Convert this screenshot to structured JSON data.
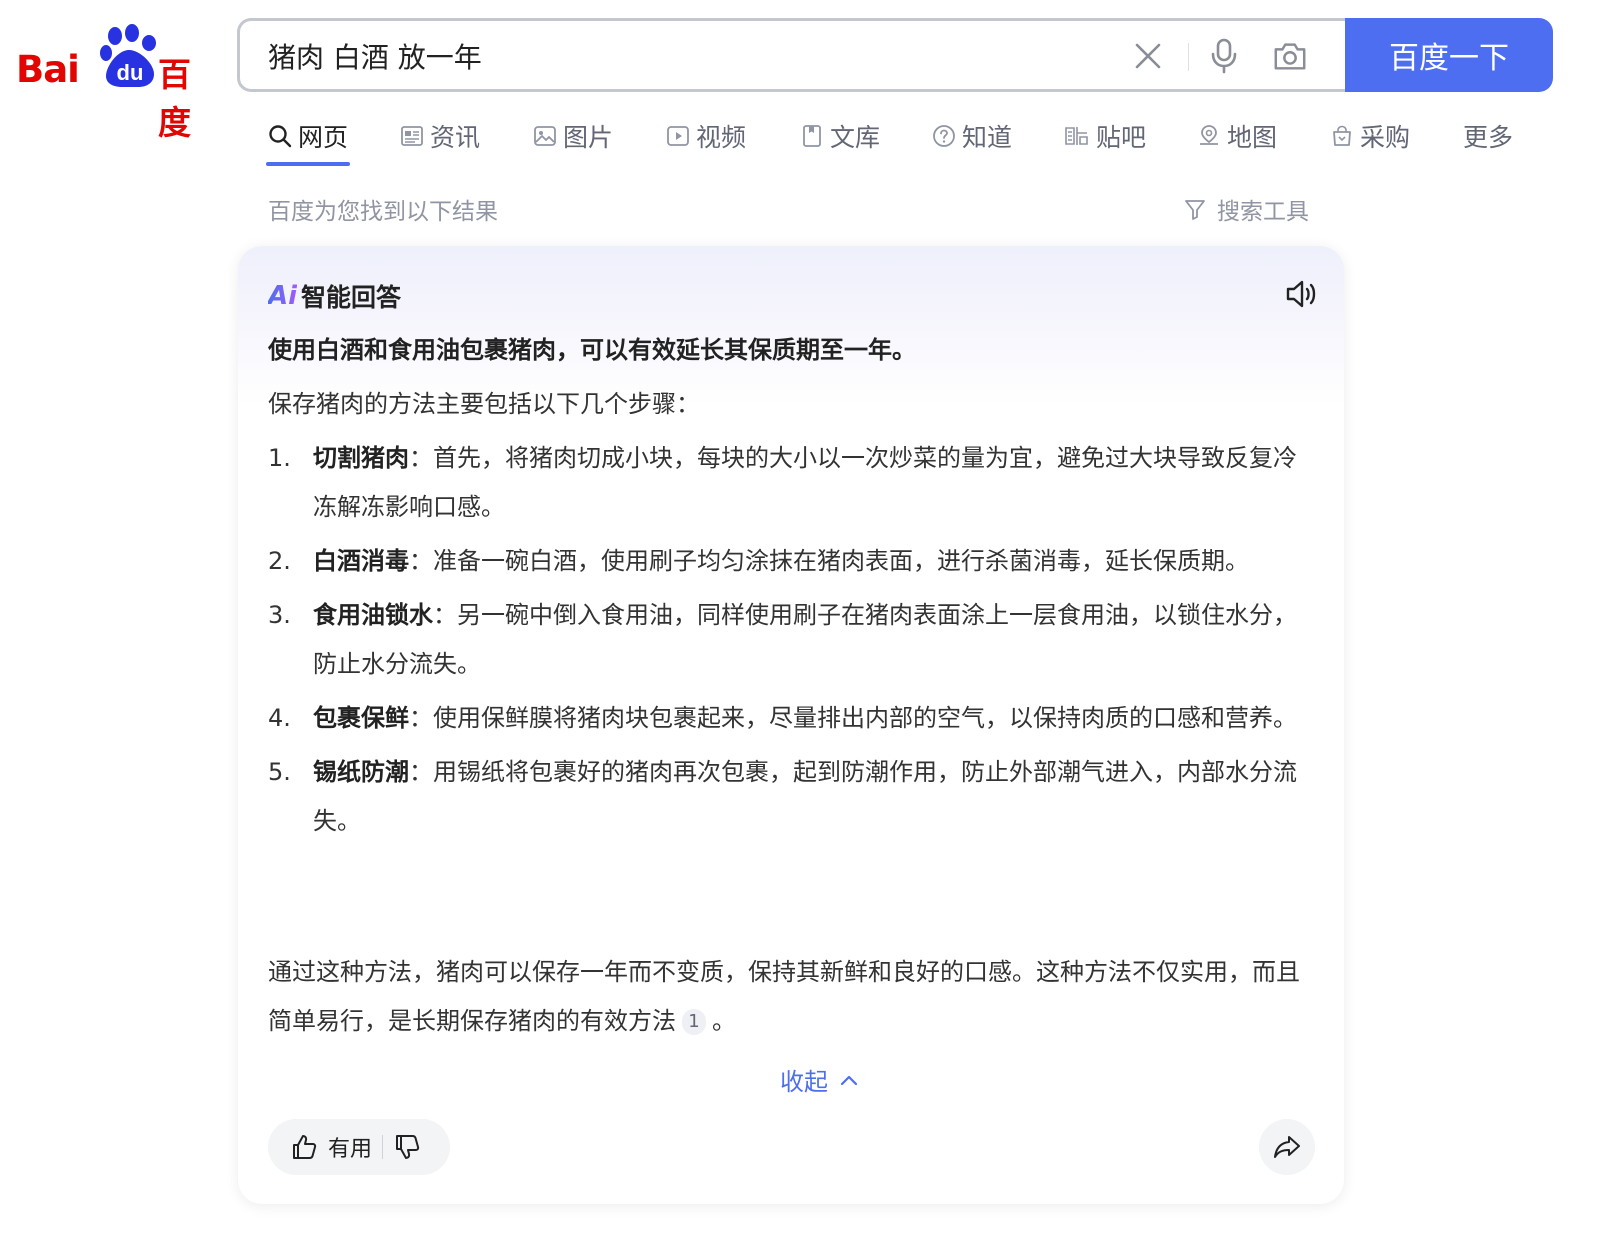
{
  "logo": {
    "latin": "Bai",
    "paw_letters": "du",
    "chinese": "百度"
  },
  "search": {
    "query": "猪肉 白酒 放一年",
    "clear_icon": "close-icon",
    "voice_icon": "microphone-icon",
    "image_icon": "camera-icon",
    "button_label": "百度一下"
  },
  "tabs": [
    {
      "label": "网页",
      "icon": "search-icon",
      "active": true
    },
    {
      "label": "资讯",
      "icon": "news-icon"
    },
    {
      "label": "图片",
      "icon": "image-icon"
    },
    {
      "label": "视频",
      "icon": "video-icon"
    },
    {
      "label": "文库",
      "icon": "document-icon"
    },
    {
      "label": "知道",
      "icon": "question-icon"
    },
    {
      "label": "贴吧",
      "icon": "tieba-icon"
    },
    {
      "label": "地图",
      "icon": "map-icon"
    },
    {
      "label": "采购",
      "icon": "shopping-bag-icon"
    },
    {
      "label": "更多"
    }
  ],
  "results_hint": "百度为您找到以下结果",
  "search_tools": "搜索工具",
  "ai_card": {
    "logo_text": "Ai",
    "title": "智能回答",
    "lead": "使用白酒和食用油包裹猪肉，可以有效延长其保质期至一年。",
    "intro": "保存猪肉的方法主要包括以下几个步骤：",
    "steps": [
      {
        "num": "1.",
        "key": "切割猪肉",
        "text": "：首先，将猪肉切成小块，每块的大小以一次炒菜的量为宜，避免过大块导致反复冷冻解冻影响口感。"
      },
      {
        "num": "2.",
        "key": "白酒消毒",
        "text": "：准备一碗白酒，使用刷子均匀涂抹在猪肉表面，进行杀菌消毒，延长保质期。"
      },
      {
        "num": "3.",
        "key": "食用油锁水",
        "text": "：另一碗中倒入食用油，同样使用刷子在猪肉表面涂上一层食用油，以锁住水分，防止水分流失。"
      },
      {
        "num": "4.",
        "key": "包裹保鲜",
        "text": "：使用保鲜膜将猪肉块包裹起来，尽量排出内部的空气，以保持肉质的口感和营养。"
      },
      {
        "num": "5.",
        "key": "锡纸防潮",
        "text": "：用锡纸将包裹好的猪肉再次包裹，起到防潮作用，防止外部潮气进入，内部水分流失。"
      }
    ],
    "summary": "通过这种方法，猪肉可以保存一年而不变质，保持其新鲜和良好的口感。这种方法不仅实用，而且简单易行，是长期保存猪肉的有效方法",
    "citation": "1",
    "summary_end": "。",
    "collapse_label": "收起",
    "useful_label": "有用"
  },
  "colors": {
    "brand_red": "#e10602",
    "brand_blue": "#4e6ef2"
  }
}
